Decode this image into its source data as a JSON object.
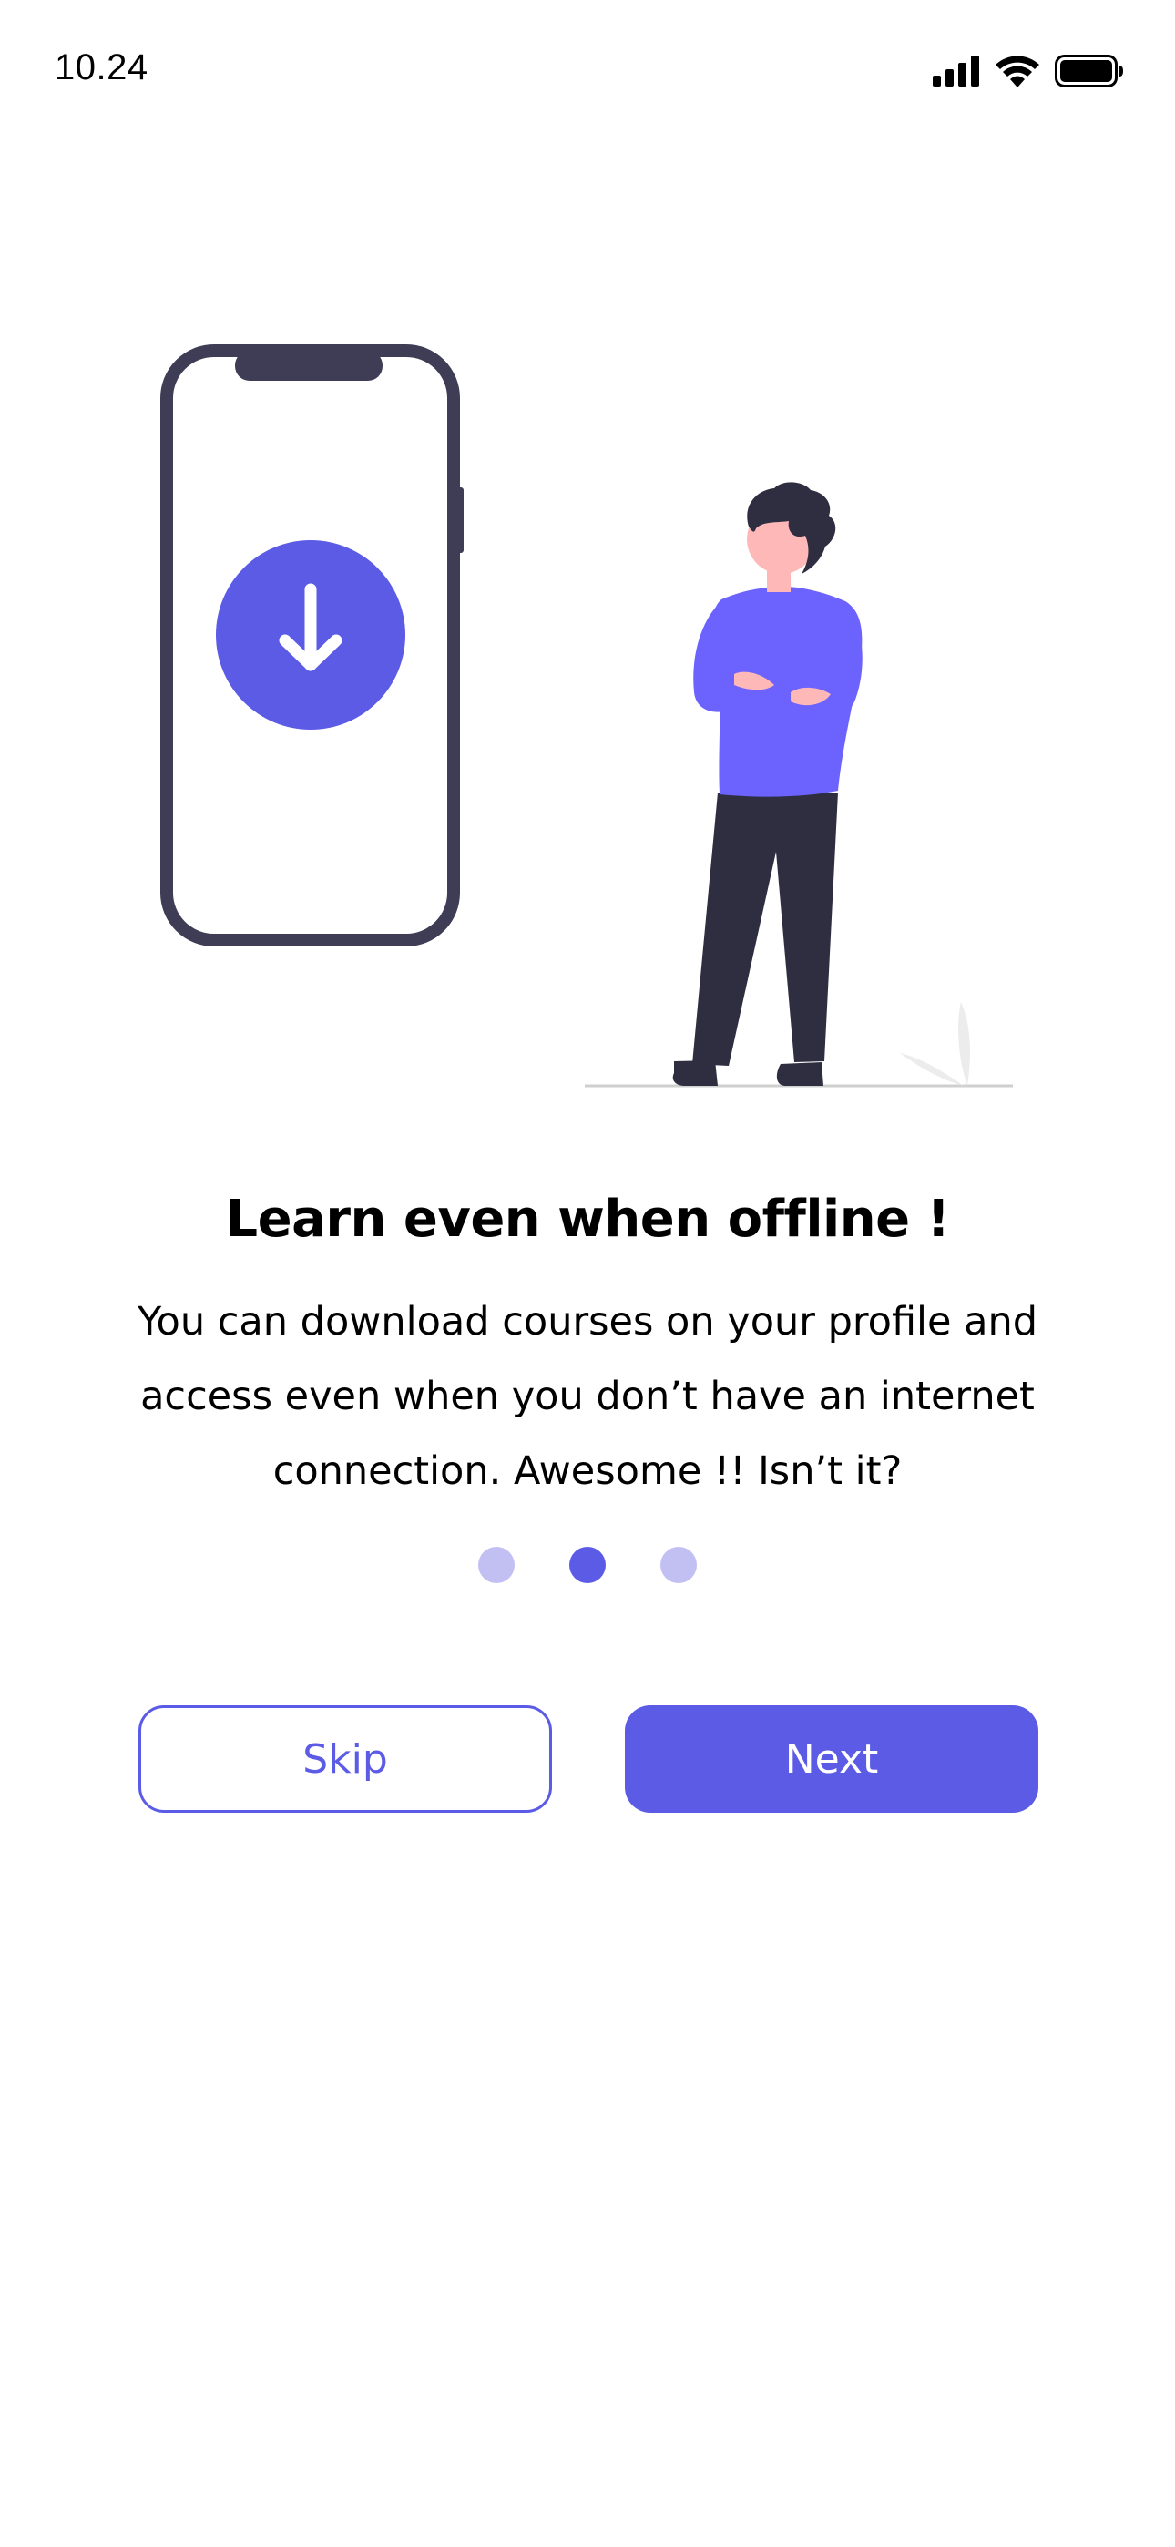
{
  "status_bar": {
    "time": "10.24",
    "icons": [
      "cellular-signal-icon",
      "wifi-icon",
      "battery-icon"
    ]
  },
  "illustration": {
    "phone_icon": "download-arrow-icon",
    "figure": "person-standing-arms-crossed"
  },
  "onboarding": {
    "title": "Learn even when offline !",
    "description_lines": [
      "You can download courses on your profile and",
      "access even when you don’t have an internet",
      "connection. Awesome !! Isn’t it?"
    ],
    "page_count": 3,
    "active_page": 2
  },
  "buttons": {
    "skip_label": "Skip",
    "next_label": "Next"
  },
  "colors": {
    "accent": "#5b5be6",
    "accent_light": "#c2c0f3",
    "phone_frame": "#3f3d56",
    "shirt": "#6c63ff",
    "pants": "#2f2e41",
    "skin": "#ffb8b8"
  }
}
